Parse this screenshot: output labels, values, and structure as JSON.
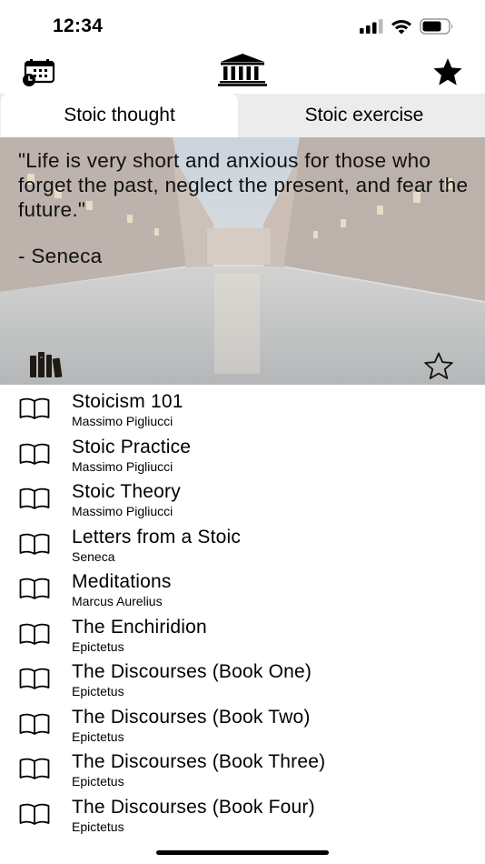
{
  "status_bar": {
    "time": "12:34",
    "icons": [
      "signal-icon",
      "wifi-icon",
      "battery-icon"
    ]
  },
  "nav": {
    "left_icon": "calendar-clock-icon",
    "center_icon": "temple-icon",
    "right_icon": "star-filled-icon"
  },
  "tabs": [
    {
      "label": "Stoic thought",
      "selected": true
    },
    {
      "label": "Stoic exercise",
      "selected": false
    }
  ],
  "quote": {
    "text": "\"Life is very short and anxious for those who forget the past, neglect the present, and fear the future.\"",
    "author": "- Seneca",
    "library_icon": "books-icon",
    "favorite_icon": "star-outline-icon"
  },
  "books": [
    {
      "title": "Stoicism 101",
      "author": "Massimo Pigliucci"
    },
    {
      "title": "Stoic Practice",
      "author": "Massimo Pigliucci"
    },
    {
      "title": "Stoic Theory",
      "author": "Massimo Pigliucci"
    },
    {
      "title": "Letters from a Stoic",
      "author": "Seneca"
    },
    {
      "title": "Meditations",
      "author": "Marcus Aurelius"
    },
    {
      "title": "The Enchiridion",
      "author": "Epictetus"
    },
    {
      "title": "The Discourses (Book One)",
      "author": "Epictetus"
    },
    {
      "title": "The Discourses (Book Two)",
      "author": "Epictetus"
    },
    {
      "title": "The Discourses (Book Three)",
      "author": "Epictetus"
    },
    {
      "title": "The Discourses (Book Four)",
      "author": "Epictetus"
    }
  ]
}
